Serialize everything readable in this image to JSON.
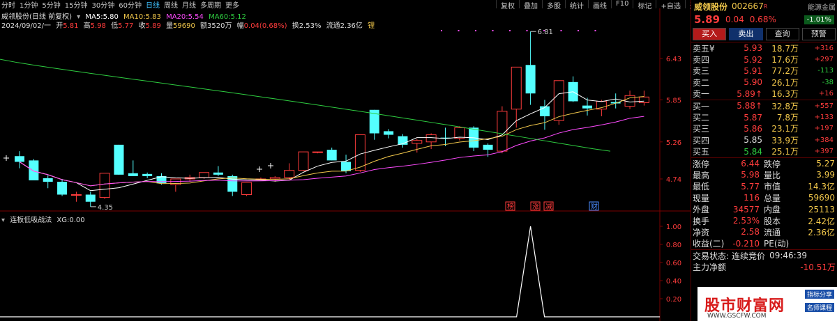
{
  "toolbar": {
    "periods": [
      "分时",
      "1分钟",
      "5分钟",
      "15分钟",
      "30分钟",
      "60分钟",
      "日线",
      "周线",
      "月线",
      "多周期",
      "更多"
    ],
    "active_period": "日线",
    "tools": [
      "复权",
      "叠加",
      "多股",
      "统计",
      "画线",
      "F10",
      "标记",
      "+自选",
      "返回"
    ]
  },
  "chart_header": {
    "title": "威领股份(日线 前复权)",
    "ma5_label": "MA5:",
    "ma5": "5.80",
    "ma10_label": "MA10:",
    "ma10": "5.83",
    "ma20_label": "MA20:",
    "ma20": "5.54",
    "ma60_label": "MA60:",
    "ma60": "5.12"
  },
  "day_info": {
    "date": "2024/09/02/一",
    "open_label": "开",
    "open": "5.81",
    "high_label": "高",
    "high": "5.98",
    "low_label": "低",
    "low": "5.77",
    "close_label": "收",
    "close": "5.89",
    "vol_label": "量",
    "vol": "59690",
    "amount_label": "额",
    "amount": "3520万",
    "change_label": "幅",
    "change": "0.04(0.68%)",
    "turnover_label": "换",
    "turnover": "2.53%",
    "float_label": "流通",
    "float": "2.36亿",
    "tag": "锂"
  },
  "indicator": {
    "name": "连板低吸战法",
    "value_label": "XG:",
    "value": "0.00"
  },
  "colors": {
    "up": "#ff3c3c",
    "down": "#54ffff",
    "ma5": "#ffffff",
    "ma10": "#f2c84b",
    "ma20": "#ff4bff",
    "ma60": "#2ecc40"
  },
  "right_panel": {
    "name": "威领股份",
    "code": "002667",
    "code_mark": "R",
    "zone": "能源金属",
    "price": "5.89",
    "change": "0.04",
    "change_pct": "0.68%",
    "index_change": "-1.01%",
    "buttons": [
      "买入",
      "卖出",
      "查询",
      "预警"
    ],
    "asks": [
      {
        "label": "卖五",
        "mark": "¥",
        "price": "5.93",
        "vol": "18.7万",
        "delta": "+316"
      },
      {
        "label": "卖四",
        "mark": "",
        "price": "5.92",
        "vol": "17.6万",
        "delta": "+297"
      },
      {
        "label": "卖三",
        "mark": "",
        "price": "5.91",
        "vol": "77.2万",
        "delta": "-113"
      },
      {
        "label": "卖二",
        "mark": "",
        "price": "5.90",
        "vol": "26.1万",
        "delta": "-38"
      },
      {
        "label": "卖一",
        "mark": "",
        "price": "5.89↑",
        "vol": "16.3万",
        "delta": "+16"
      }
    ],
    "bids": [
      {
        "label": "买一",
        "price": "5.88↑",
        "vol": "32.8万",
        "delta": "+557"
      },
      {
        "label": "买二",
        "price": "5.87",
        "vol": "7.8万",
        "delta": "+133"
      },
      {
        "label": "买三",
        "price": "5.86",
        "vol": "23.1万",
        "delta": "+197"
      },
      {
        "label": "买四",
        "price": "5.85",
        "vol": "33.9万",
        "delta": "+384"
      },
      {
        "label": "买五",
        "price": "5.84",
        "vol": "25.1万",
        "delta": "+397"
      }
    ],
    "stats": [
      {
        "k1": "涨停",
        "v1": "6.44",
        "k2": "跌停",
        "v2": "5.27"
      },
      {
        "k1": "最高",
        "v1": "5.98",
        "k2": "量比",
        "v2": "3.99"
      },
      {
        "k1": "最低",
        "v1": "5.77",
        "k2": "市值",
        "v2": "14.3亿"
      },
      {
        "k1": "现量",
        "v1": "116",
        "k2": "总量",
        "v2": "59690"
      },
      {
        "k1": "外盘",
        "v1": "34577",
        "k2": "内盘",
        "v2": "25113"
      },
      {
        "k1": "换手",
        "v1": "2.53%",
        "k2": "股本",
        "v2": "2.42亿"
      },
      {
        "k1": "净资",
        "v1": "2.58",
        "k2": "流通",
        "v2": "2.36亿"
      },
      {
        "k1": "收益(二)",
        "v1": "-0.210",
        "k2": "PE(动)",
        "v2": ""
      }
    ],
    "trade_status_label": "交易状态:",
    "trade_status": "连续竞价",
    "trade_time": "09:46:39",
    "next_row_label": "主力净额",
    "next_row_value": "-10.51万"
  },
  "watermark": {
    "title": "股市财富网",
    "url": "WWW.GSCFW.COM",
    "badge1": "指标分享",
    "badge2": "名师课程"
  },
  "chart_data": {
    "type": "candlestick",
    "price_axis_ticks": [
      "6.43",
      "5.85",
      "5.26",
      "4.74"
    ],
    "indicator_axis_ticks": [
      "1.00",
      "0.80",
      "0.60",
      "0.40",
      "0.20"
    ],
    "high_label": "6.81",
    "low_label": "4.35",
    "event_tags": [
      "榜",
      "涨",
      "减",
      "财"
    ],
    "candles": [
      {
        "o": 5.06,
        "h": 5.13,
        "l": 4.89,
        "c": 4.98
      },
      {
        "o": 5.0,
        "h": 5.02,
        "l": 4.73,
        "c": 4.72
      },
      {
        "o": 4.75,
        "h": 4.79,
        "l": 4.61,
        "c": 4.7
      },
      {
        "o": 4.7,
        "h": 4.74,
        "l": 4.5,
        "c": 4.52
      },
      {
        "o": 4.52,
        "h": 4.56,
        "l": 4.42,
        "c": 4.52
      },
      {
        "o": 4.52,
        "h": 4.56,
        "l": 4.35,
        "c": 4.42
      },
      {
        "o": 4.48,
        "h": 4.82,
        "l": 4.46,
        "c": 4.82
      },
      {
        "o": 5.22,
        "h": 5.22,
        "l": 4.8,
        "c": 4.8
      },
      {
        "o": 4.82,
        "h": 5.0,
        "l": 4.78,
        "c": 4.78
      },
      {
        "o": 4.81,
        "h": 4.83,
        "l": 4.75,
        "c": 4.78
      },
      {
        "o": 4.78,
        "h": 4.82,
        "l": 4.66,
        "c": 4.68
      },
      {
        "o": 4.66,
        "h": 4.74,
        "l": 4.56,
        "c": 4.74
      },
      {
        "o": 4.74,
        "h": 4.8,
        "l": 4.7,
        "c": 4.76
      },
      {
        "o": 4.76,
        "h": 4.83,
        "l": 4.74,
        "c": 4.83
      },
      {
        "o": 4.83,
        "h": 4.92,
        "l": 4.78,
        "c": 4.8
      },
      {
        "o": 4.78,
        "h": 4.8,
        "l": 4.5,
        "c": 4.56
      },
      {
        "o": 4.52,
        "h": 4.69,
        "l": 4.5,
        "c": 4.69
      },
      {
        "o": 4.73,
        "h": 4.76,
        "l": 4.72,
        "c": 4.74
      },
      {
        "o": 4.74,
        "h": 4.78,
        "l": 4.7,
        "c": 4.76
      },
      {
        "o": 4.76,
        "h": 4.96,
        "l": 4.73,
        "c": 4.86
      },
      {
        "o": 4.86,
        "h": 5.12,
        "l": 4.85,
        "c": 5.12
      },
      {
        "o": 5.12,
        "h": 5.12,
        "l": 5.1,
        "c": 5.12
      },
      {
        "o": 5.15,
        "h": 5.18,
        "l": 5.0,
        "c": 5.0
      },
      {
        "o": 4.98,
        "h": 5.08,
        "l": 4.82,
        "c": 4.85
      },
      {
        "o": 4.86,
        "h": 5.36,
        "l": 4.84,
        "c": 5.36
      },
      {
        "o": 5.71,
        "h": 5.71,
        "l": 5.29,
        "c": 5.38
      },
      {
        "o": 5.41,
        "h": 5.44,
        "l": 5.31,
        "c": 5.36
      },
      {
        "o": 5.34,
        "h": 5.37,
        "l": 5.18,
        "c": 5.22
      },
      {
        "o": 5.24,
        "h": 5.3,
        "l": 5.11,
        "c": 5.28
      },
      {
        "o": 5.26,
        "h": 5.38,
        "l": 5.16,
        "c": 5.36
      },
      {
        "o": 5.32,
        "h": 5.46,
        "l": 5.2,
        "c": 5.31
      },
      {
        "o": 5.31,
        "h": 5.48,
        "l": 5.28,
        "c": 5.46
      },
      {
        "o": 5.46,
        "h": 5.48,
        "l": 5.13,
        "c": 5.18
      },
      {
        "o": 5.22,
        "h": 5.24,
        "l": 5.05,
        "c": 5.15
      },
      {
        "o": 5.13,
        "h": 5.76,
        "l": 5.1,
        "c": 5.69
      },
      {
        "o": 5.72,
        "h": 6.31,
        "l": 5.46,
        "c": 6.31
      },
      {
        "o": 6.34,
        "h": 6.81,
        "l": 5.78,
        "c": 5.94
      },
      {
        "o": 5.76,
        "h": 5.85,
        "l": 5.43,
        "c": 5.62
      },
      {
        "o": 5.56,
        "h": 6.12,
        "l": 5.5,
        "c": 6.12
      },
      {
        "o": 6.1,
        "h": 6.18,
        "l": 5.82,
        "c": 5.83
      },
      {
        "o": 5.77,
        "h": 5.88,
        "l": 5.63,
        "c": 5.73
      },
      {
        "o": 5.72,
        "h": 5.85,
        "l": 5.62,
        "c": 5.83
      },
      {
        "o": 5.82,
        "h": 5.94,
        "l": 5.73,
        "c": 5.8
      },
      {
        "o": 5.76,
        "h": 5.98,
        "l": 5.72,
        "c": 5.91
      },
      {
        "o": 5.81,
        "h": 5.98,
        "l": 5.77,
        "c": 5.89
      }
    ],
    "xg_spike_index": 36
  }
}
